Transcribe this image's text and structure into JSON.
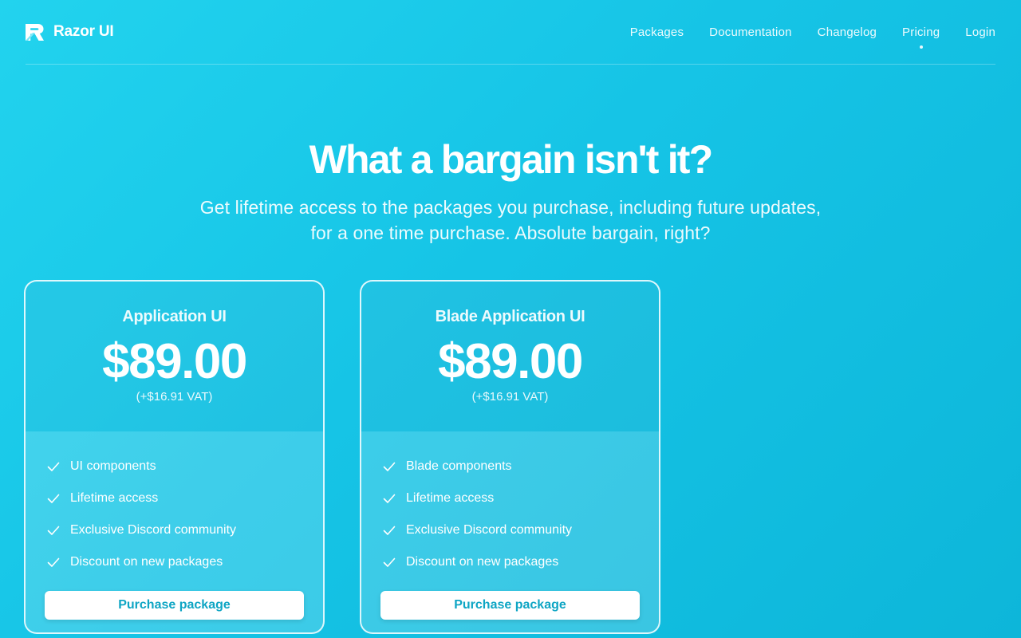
{
  "brand": {
    "name": "Razor UI",
    "logo_icon": "razor-logo-icon"
  },
  "nav": {
    "items": [
      {
        "label": "Packages"
      },
      {
        "label": "Documentation"
      },
      {
        "label": "Changelog"
      },
      {
        "label": "Pricing",
        "active": true
      },
      {
        "label": "Login"
      }
    ]
  },
  "hero": {
    "title": "What a bargain isn't it?",
    "subtitle": "Get lifetime access to the packages you purchase, including future updates, for a one time purchase. Absolute bargain, right?"
  },
  "plans": [
    {
      "title": "Application UI",
      "price": "$89.00",
      "vat": "(+$16.91 VAT)",
      "features": [
        "UI components",
        "Lifetime access",
        "Exclusive Discord community",
        "Discount on new packages"
      ],
      "button": "Purchase package"
    },
    {
      "title": "Blade Application UI",
      "price": "$89.00",
      "vat": "(+$16.91 VAT)",
      "features": [
        "Blade components",
        "Lifetime access",
        "Exclusive Discord community",
        "Discount on new packages"
      ],
      "button": "Purchase package"
    }
  ],
  "colors": {
    "background": "#22d3ee",
    "accent_text": "#0ea5c4",
    "text": "#ffffff"
  }
}
